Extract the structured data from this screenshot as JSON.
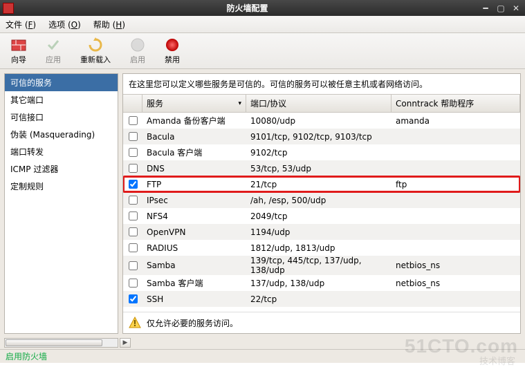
{
  "title": "防火墙配置",
  "menubar": [
    {
      "label": "文件",
      "accel": "F"
    },
    {
      "label": "选项",
      "accel": "O"
    },
    {
      "label": "帮助",
      "accel": "H"
    }
  ],
  "toolbar": {
    "wizard": "向导",
    "apply": "应用",
    "reload": "重新载入",
    "enable": "启用",
    "disable": "禁用"
  },
  "sidebar": {
    "items": [
      "可信的服务",
      "其它端口",
      "可信接口",
      "伪装 (Masquerading)",
      "端口转发",
      "ICMP 过滤器",
      "定制规则"
    ],
    "selected": 0
  },
  "main": {
    "caption": "在这里您可以定义哪些服务是可信的。可信的服务可以被任意主机或者网络访问。",
    "columns": {
      "service": "服务",
      "port": "端口/协议",
      "conntrack": "Conntrack 帮助程序"
    },
    "rows": [
      {
        "checked": false,
        "svc": "Amanda 备份客户端",
        "port": "10080/udp",
        "conn": "amanda"
      },
      {
        "checked": false,
        "svc": "Bacula",
        "port": "9101/tcp, 9102/tcp, 9103/tcp",
        "conn": ""
      },
      {
        "checked": false,
        "svc": "Bacula 客户端",
        "port": "9102/tcp",
        "conn": ""
      },
      {
        "checked": false,
        "svc": "DNS",
        "port": "53/tcp, 53/udp",
        "conn": ""
      },
      {
        "checked": true,
        "svc": "FTP",
        "port": "21/tcp",
        "conn": "ftp",
        "highlight": true
      },
      {
        "checked": false,
        "svc": "IPsec",
        "port": "/ah, /esp, 500/udp",
        "conn": ""
      },
      {
        "checked": false,
        "svc": "NFS4",
        "port": "2049/tcp",
        "conn": ""
      },
      {
        "checked": false,
        "svc": "OpenVPN",
        "port": "1194/udp",
        "conn": ""
      },
      {
        "checked": false,
        "svc": "RADIUS",
        "port": "1812/udp, 1813/udp",
        "conn": ""
      },
      {
        "checked": false,
        "svc": "Samba",
        "port": "139/tcp, 445/tcp, 137/udp, 138/udp",
        "conn": "netbios_ns"
      },
      {
        "checked": false,
        "svc": "Samba 客户端",
        "port": "137/udp, 138/udp",
        "conn": "netbios_ns"
      },
      {
        "checked": true,
        "svc": "SSH",
        "port": "22/tcp",
        "conn": ""
      }
    ],
    "warning": "仅允许必要的服务访问。"
  },
  "status": "启用防火墙",
  "watermark": {
    "main": "51CTO.com",
    "sub": "技术博客"
  }
}
